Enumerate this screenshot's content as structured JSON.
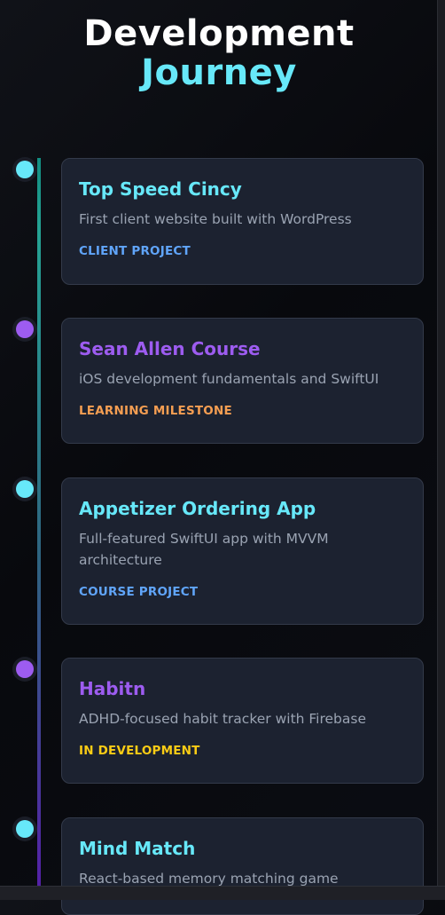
{
  "header": {
    "title_line1": "Development",
    "title_line2": "Journey"
  },
  "timeline": {
    "items": [
      {
        "title": "Top Speed Cincy",
        "description": "First client website built with WordPress",
        "tag": "CLIENT PROJECT",
        "dot_color": "#67e8f9",
        "title_color": "#67e8f9",
        "tag_color": "#60a5fa"
      },
      {
        "title": "Sean Allen Course",
        "description": "iOS development fundamentals and SwiftUI",
        "tag": "LEARNING MILESTONE",
        "dot_color": "#9d5cf0",
        "title_color": "#9d5cf0",
        "tag_color": "#f59e52"
      },
      {
        "title": "Appetizer Ordering App",
        "description": "Full-featured SwiftUI app with MVVM architecture",
        "tag": "COURSE PROJECT",
        "dot_color": "#67e8f9",
        "title_color": "#67e8f9",
        "tag_color": "#60a5fa"
      },
      {
        "title": "Habitn",
        "description": "ADHD-focused habit tracker with Firebase",
        "tag": "IN DEVELOPMENT",
        "dot_color": "#9d5cf0",
        "title_color": "#9d5cf0",
        "tag_color": "#facc15"
      },
      {
        "title": "Mind Match",
        "description": "React-based memory matching game",
        "tag": "",
        "dot_color": "#67e8f9",
        "title_color": "#67e8f9",
        "tag_color": "#60a5fa"
      }
    ]
  }
}
